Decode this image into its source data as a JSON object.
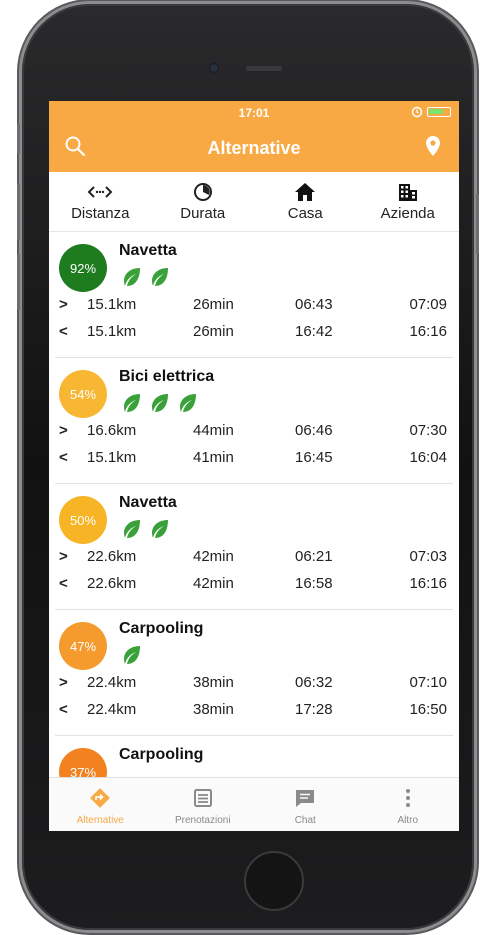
{
  "status_bar": {
    "time": "17:01"
  },
  "header": {
    "title": "Alternative",
    "search_icon": "search-icon",
    "location_icon": "map-pin-icon"
  },
  "filters": [
    {
      "label": "Distanza",
      "icon": "distance-arrows-icon"
    },
    {
      "label": "Durata",
      "icon": "clock-icon"
    },
    {
      "label": "Casa",
      "icon": "home-icon"
    },
    {
      "label": "Azienda",
      "icon": "building-icon"
    }
  ],
  "alternatives": [
    {
      "title": "Navetta",
      "score": "92%",
      "score_color": "#1e7b1e",
      "leaves": 2,
      "outbound": {
        "arrow": ">",
        "distance": "15.1km",
        "duration": "26min",
        "depart": "06:43",
        "arrive": "07:09"
      },
      "return": {
        "arrow": "<",
        "distance": "15.1km",
        "duration": "26min",
        "depart": "16:42",
        "arrive": "16:16"
      }
    },
    {
      "title": "Bici elettrica",
      "score": "54%",
      "score_color": "#f7b733",
      "leaves": 3,
      "outbound": {
        "arrow": ">",
        "distance": "16.6km",
        "duration": "44min",
        "depart": "06:46",
        "arrive": "07:30"
      },
      "return": {
        "arrow": "<",
        "distance": "15.1km",
        "duration": "41min",
        "depart": "16:45",
        "arrive": "16:04"
      }
    },
    {
      "title": "Navetta",
      "score": "50%",
      "score_color": "#f7b424",
      "leaves": 2,
      "outbound": {
        "arrow": ">",
        "distance": "22.6km",
        "duration": "42min",
        "depart": "06:21",
        "arrive": "07:03"
      },
      "return": {
        "arrow": "<",
        "distance": "22.6km",
        "duration": "42min",
        "depart": "16:58",
        "arrive": "16:16"
      }
    },
    {
      "title": "Carpooling",
      "score": "47%",
      "score_color": "#f59b2e",
      "leaves": 1,
      "outbound": {
        "arrow": ">",
        "distance": "22.4km",
        "duration": "38min",
        "depart": "06:32",
        "arrive": "07:10"
      },
      "return": {
        "arrow": "<",
        "distance": "22.4km",
        "duration": "38min",
        "depart": "17:28",
        "arrive": "16:50"
      }
    },
    {
      "title": "Carpooling",
      "score": "37%",
      "score_color": "#f2821f",
      "leaves": 0
    }
  ],
  "tabbar": [
    {
      "label": "Alternative",
      "icon": "directions-icon",
      "active": true
    },
    {
      "label": "Prenotazioni",
      "icon": "list-icon",
      "active": false
    },
    {
      "label": "Chat",
      "icon": "chat-icon",
      "active": false
    },
    {
      "label": "Altro",
      "icon": "more-vertical-icon",
      "active": false
    }
  ],
  "colors": {
    "accent": "#f8a943",
    "leaf": "#3aa13a"
  }
}
